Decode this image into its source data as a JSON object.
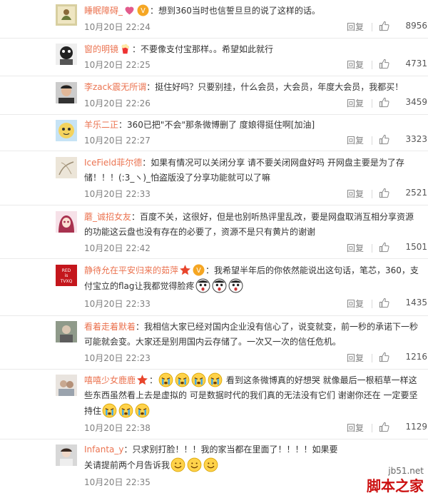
{
  "colors": {
    "username": "#eb7350",
    "meta": "#808080",
    "watermark": "#cc1111"
  },
  "reply_label": "回复",
  "comments": [
    {
      "name": "睡眠障碍_",
      "text": "：想到360当时也信誓旦旦的说了这样的话。",
      "time": "10月20日 22:24",
      "likes": "8956"
    },
    {
      "name": "窗的明镜",
      "text": "：不要像支付宝那样。。希望如此就行",
      "time": "10月20日 22:25",
      "likes": "4731"
    },
    {
      "name": "李zack震无所谓",
      "text": "：挺住好吗？只要别挂，什么会员，大会员，年度大会员，我都买！",
      "time": "10月20日 22:26",
      "likes": "3459"
    },
    {
      "name": "羊乐二正",
      "text": "：360已把\"不会\"那条微博删了 度娘得挺住啊[加油]",
      "time": "10月20日 22:27",
      "likes": "3323"
    },
    {
      "name": "IceField菲尔德",
      "text": "：如果有情况可以关闭分享 请不要关闭网盘好吗  开网盘主要是为了存储！！！(:3_ヽ)_怕盗版没了分享功能就可以了嘛",
      "time": "10月20日 22:33",
      "likes": "2521"
    },
    {
      "name": "蘑_诚招女友",
      "text": "：百度不关，这很好，但是也别听热评里乱改，要是网盘取消互相分享资源的功能这云盘也没有存在的必要了，资源不是只有黄片的谢谢",
      "time": "10月20日 22:42",
      "likes": "1501"
    },
    {
      "name": "静待允在平安归来的茹萍",
      "text": "：我希望半年后的你依然能说出这句话，笔芯，360，支付宝立的flag让我都觉得脸疼",
      "time": "10月20日 22:33",
      "likes": "1435"
    },
    {
      "name": "看着走着默着",
      "text": "：我相信大家已经对国内企业没有信心了，说变就变，前一秒的承诺下一秒可能就会变。大家还是别用国内云存储了。一次又一次的信任危机。",
      "time": "10月20日 22:23",
      "likes": "1216"
    },
    {
      "name": "嘻嘻少女鹿鹿",
      "text1": "看到这条微博真的好想哭 就像最后一根稻草一样这些东西虽然看上去是虚拟的 可是数据时代的我们真的无法没有它们 谢谢你还在 一定要坚持住",
      "time": "10月20日 22:38",
      "likes": "1129"
    },
    {
      "name": "Infanta_y",
      "text": "：只求别打脸！！！我的家当都在里面了！！！！如果要关请提前两个月告诉我",
      "time": "10月20日 22:35",
      "likes": ""
    }
  ],
  "watermark": {
    "url": "jb51.net",
    "name": "脚本之家"
  }
}
